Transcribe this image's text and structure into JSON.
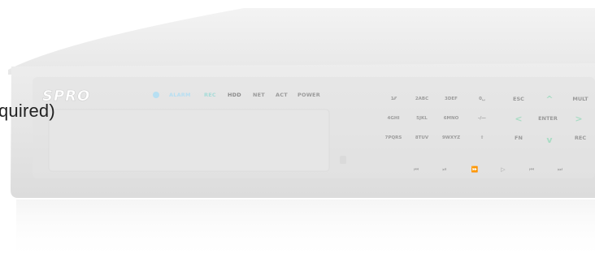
{
  "overlay": {
    "text": "quired)"
  },
  "device": {
    "brand": "SPRO",
    "status_lights": [
      "ALARM",
      "REC",
      "HDD",
      "NET",
      "ACT",
      "POWER"
    ],
    "keypad": [
      [
        "1⁄⁄⁄",
        "2ABC",
        "3DEF",
        "0␣"
      ],
      [
        "4GHI",
        "5JKL",
        "6MNO",
        "-/—"
      ],
      [
        "7PQRS",
        "8TUV",
        "9WXYZ",
        "⇧"
      ]
    ],
    "nav": {
      "esc": "ESC",
      "enter": "ENTER",
      "fn": "FN",
      "mult": "MULT",
      "rec": "REC"
    },
    "playback_glyphs": [
      "⏮",
      "⏯",
      "⏩",
      "▷",
      "⏮",
      "⏭"
    ]
  },
  "colors": {
    "panel": "#eeeeee",
    "front": "#e9e9e9",
    "alarm": "#b7dff2",
    "rec": "#a6dcd8",
    "hdd": "#8a8a8a",
    "arrow": "#a9dcc4"
  }
}
